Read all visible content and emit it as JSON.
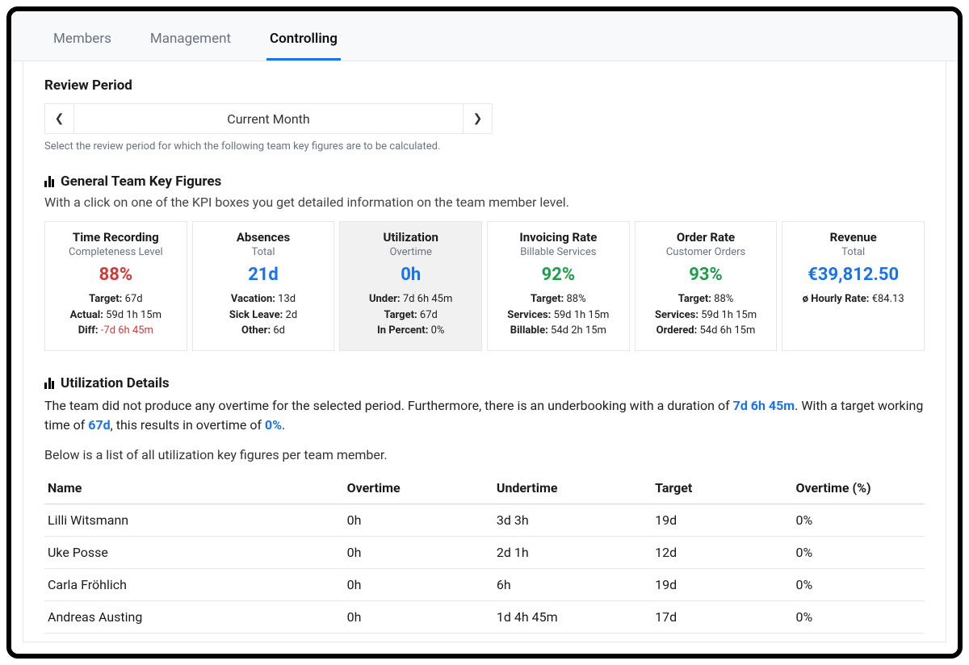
{
  "tabs": {
    "members": "Members",
    "management": "Management",
    "controlling": "Controlling"
  },
  "period": {
    "title": "Review Period",
    "value": "Current Month",
    "helper": "Select the review period for which the following team key figures are to be calculated."
  },
  "kpi_section": {
    "title": "General Team Key Figures",
    "sub": "With a click on one of the KPI boxes you get detailed information on the team member level."
  },
  "kpis": {
    "time_recording": {
      "title": "Time Recording",
      "sub": "Completeness Level",
      "main": "88%",
      "l1_lbl": "Target:",
      "l1_val": "67d",
      "l2_lbl": "Actual:",
      "l2_val": "59d 1h 15m",
      "l3_lbl": "Diff:",
      "l3_val": "-7d 6h 45m"
    },
    "absences": {
      "title": "Absences",
      "sub": "Total",
      "main": "21d",
      "l1_lbl": "Vacation:",
      "l1_val": "13d",
      "l2_lbl": "Sick Leave:",
      "l2_val": "2d",
      "l3_lbl": "Other:",
      "l3_val": "6d"
    },
    "utilization": {
      "title": "Utilization",
      "sub": "Overtime",
      "main": "0h",
      "l1_lbl": "Under:",
      "l1_val": "7d 6h 45m",
      "l2_lbl": "Target:",
      "l2_val": "67d",
      "l3_lbl": "In Percent:",
      "l3_val": "0%"
    },
    "invoicing": {
      "title": "Invoicing Rate",
      "sub": "Billable Services",
      "main": "92%",
      "l1_lbl": "Target:",
      "l1_val": "88%",
      "l2_lbl": "Services:",
      "l2_val": "59d 1h 15m",
      "l3_lbl": "Billable:",
      "l3_val": "54d 2h 15m"
    },
    "order_rate": {
      "title": "Order Rate",
      "sub": "Customer Orders",
      "main": "93%",
      "l1_lbl": "Target:",
      "l1_val": "88%",
      "l2_lbl": "Services:",
      "l2_val": "59d 1h 15m",
      "l3_lbl": "Ordered:",
      "l3_val": "54d 6h 15m"
    },
    "revenue": {
      "title": "Revenue",
      "sub": "Total",
      "main": "€39,812.50",
      "l1_lbl": "ø Hourly Rate:",
      "l1_val": "€84.13"
    }
  },
  "details": {
    "title": "Utilization Details",
    "p1a": "The team did not produce any overtime for the selected period. Furthermore, there is an underbooking with a duration of ",
    "under_val": "7d 6h 45m",
    "p1b": ". With a target working time of ",
    "target_val": "67d",
    "p1c": ", this results in overtime of ",
    "pct_val": "0%",
    "p1d": ".",
    "sub": "Below is a list of all utilization key figures per team member.",
    "headers": {
      "name": "Name",
      "overtime": "Overtime",
      "undertime": "Undertime",
      "target": "Target",
      "pct": "Overtime (%)"
    },
    "rows": [
      {
        "name": "Lilli Witsmann",
        "overtime": "0h",
        "undertime": "3d 3h",
        "target": "19d",
        "pct": "0%"
      },
      {
        "name": "Uke Posse",
        "overtime": "0h",
        "undertime": "2d 1h",
        "target": "12d",
        "pct": "0%"
      },
      {
        "name": "Carla Fröhlich",
        "overtime": "0h",
        "undertime": "6h",
        "target": "19d",
        "pct": "0%"
      },
      {
        "name": "Andreas Austing",
        "overtime": "0h",
        "undertime": "1d 4h 45m",
        "target": "17d",
        "pct": "0%"
      }
    ]
  }
}
